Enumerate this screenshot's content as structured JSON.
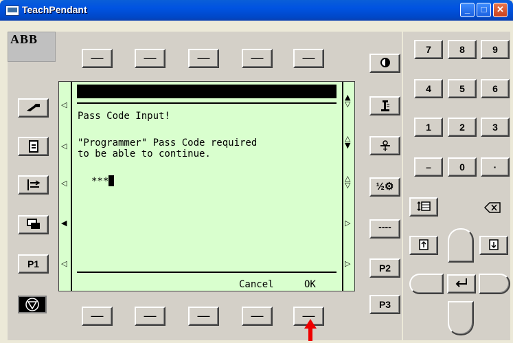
{
  "window": {
    "title": "TeachPendant",
    "minimize_icon": "minimize-icon",
    "maximize_icon": "maximize-icon",
    "close_icon": "close-icon"
  },
  "branding": {
    "logo_text": "ABB"
  },
  "function_keys": {
    "top": [
      "—",
      "—",
      "—",
      "—",
      "—"
    ],
    "bottom": [
      "—",
      "—",
      "—",
      "—",
      "—"
    ]
  },
  "left_keys": {
    "p1_label": "P1",
    "icons": [
      "jog-icon",
      "program-editor-icon",
      "misc-window-icon",
      "window-stack-icon",
      "emergency-stop-icon"
    ]
  },
  "right_keys": {
    "p2_label": "P2",
    "p3_label": "P3",
    "icons": [
      "contrast-icon",
      "motion-unit-icon",
      "tool-icon",
      "increment-icon",
      "more-icon"
    ],
    "more_label": "----",
    "increment_label": "½"
  },
  "screen": {
    "title": "Pass Code Input!",
    "message_line1": "\"Programmer\" Pass Code required",
    "message_line2": "to be able to continue.",
    "input_value": "***",
    "softkeys": {
      "cancel": "Cancel",
      "ok": "OK"
    }
  },
  "keypad": {
    "rows": [
      [
        "7",
        "8",
        "9"
      ],
      [
        "4",
        "5",
        "6"
      ],
      [
        "1",
        "2",
        "3"
      ],
      [
        "–",
        "0",
        "·"
      ]
    ],
    "icons": [
      "insert-line-icon",
      "backspace-icon",
      "page-up-icon",
      "page-down-icon",
      "enter-icon",
      "arrow-up-icon",
      "arrow-down-icon",
      "arrow-left-icon",
      "arrow-right-icon"
    ]
  },
  "colors": {
    "screen_bg": "#d9ffce",
    "titlebar": "#0053e1",
    "annotation_arrow": "#ee0000"
  }
}
